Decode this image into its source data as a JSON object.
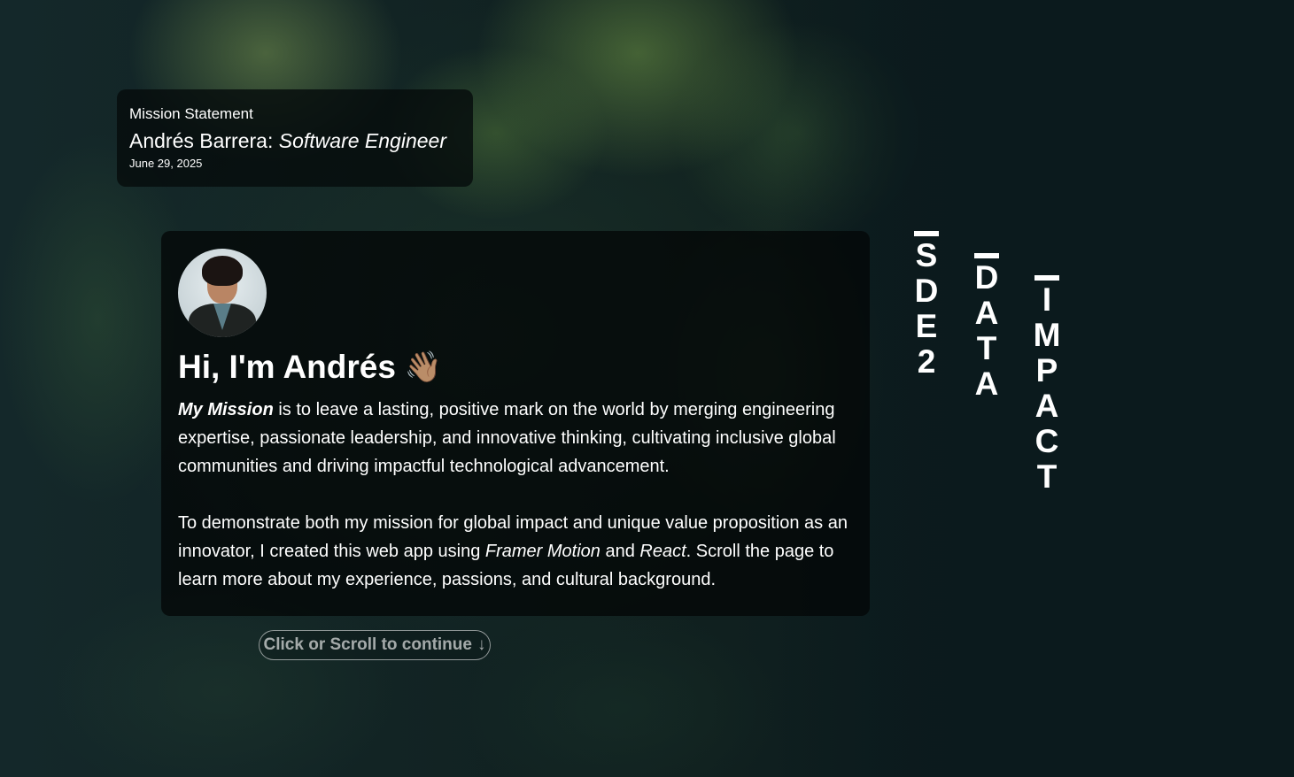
{
  "header": {
    "eyebrow": "Mission Statement",
    "name": "Andrés Barrera:",
    "role": "Software Engineer",
    "date": "June 29, 2025"
  },
  "intro": {
    "greeting": "Hi, I'm Andrés",
    "wave_emoji": "👋🏽",
    "mission_label": "My Mission",
    "mission_text": " is to leave a lasting, positive mark on the world by merging engineering expertise, passionate leadership, and innovative thinking, cultivating inclusive global communities and driving impactful technological advancement.",
    "p2_a": "To demonstrate both my mission for global impact and unique value proposition as an innovator, I created this web app using ",
    "p2_framer": "Framer Motion",
    "p2_and": " and ",
    "p2_react": "React",
    "p2_b": ". Scroll the page to learn more about my experience, passions, and cultural background."
  },
  "continue_button": {
    "label": "Click or Scroll to continue",
    "arrow": "↓"
  },
  "side_nav": [
    {
      "id": "sde2",
      "letters": [
        "S",
        "D",
        "E",
        "2"
      ]
    },
    {
      "id": "data",
      "letters": [
        "D",
        "A",
        "T",
        "A"
      ]
    },
    {
      "id": "impact",
      "letters": [
        "I",
        "M",
        "P",
        "A",
        "C",
        "T"
      ]
    }
  ],
  "icons": {
    "avatar": "profile-photo",
    "wave": "waving-hand-icon",
    "arrow": "arrow-down-icon"
  }
}
